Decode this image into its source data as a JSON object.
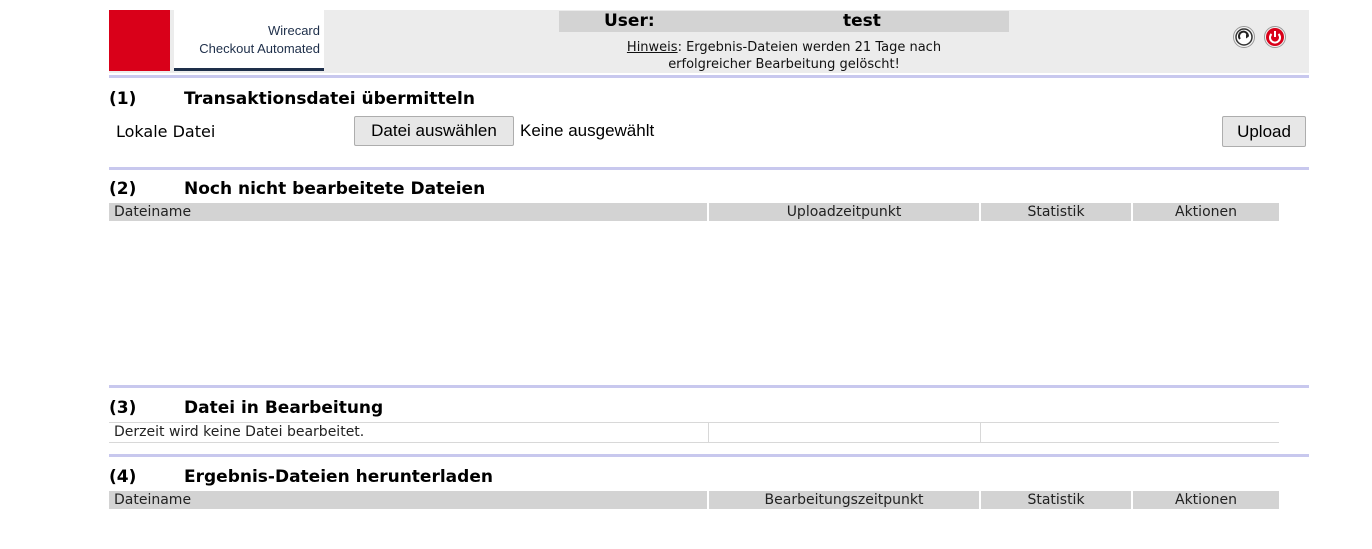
{
  "header": {
    "logo_line1": "Wirecard",
    "logo_line2": "Checkout Automated",
    "user_label": "User:",
    "user_value": "test",
    "hint_link": "Hinweis",
    "hint_line1_rest": ": Ergebnis-Dateien werden 21 Tage nach",
    "hint_line2": "erfolgreicher Bearbeitung gelöscht!",
    "icons": [
      "refresh-icon",
      "power-icon"
    ],
    "brand_color": "#d90019"
  },
  "section1": {
    "number": "(1)",
    "title": "Transaktionsdatei übermitteln",
    "local_file_label": "Lokale Datei",
    "choose_file_button": "Datei auswählen",
    "no_file_text": "Keine ausgewählt",
    "upload_button": "Upload"
  },
  "section2": {
    "number": "(2)",
    "title": "Noch nicht bearbeitete Dateien",
    "columns": [
      "Dateiname",
      "Uploadzeitpunkt",
      "Statistik",
      "Aktionen"
    ]
  },
  "section3": {
    "number": "(3)",
    "title": "Datei in Bearbeitung",
    "empty_text": "Derzeit wird keine Datei bearbeitet."
  },
  "section4": {
    "number": "(4)",
    "title": "Ergebnis-Dateien herunterladen",
    "columns": [
      "Dateiname",
      "Bearbeitungszeitpunkt",
      "Statistik",
      "Aktionen"
    ]
  }
}
